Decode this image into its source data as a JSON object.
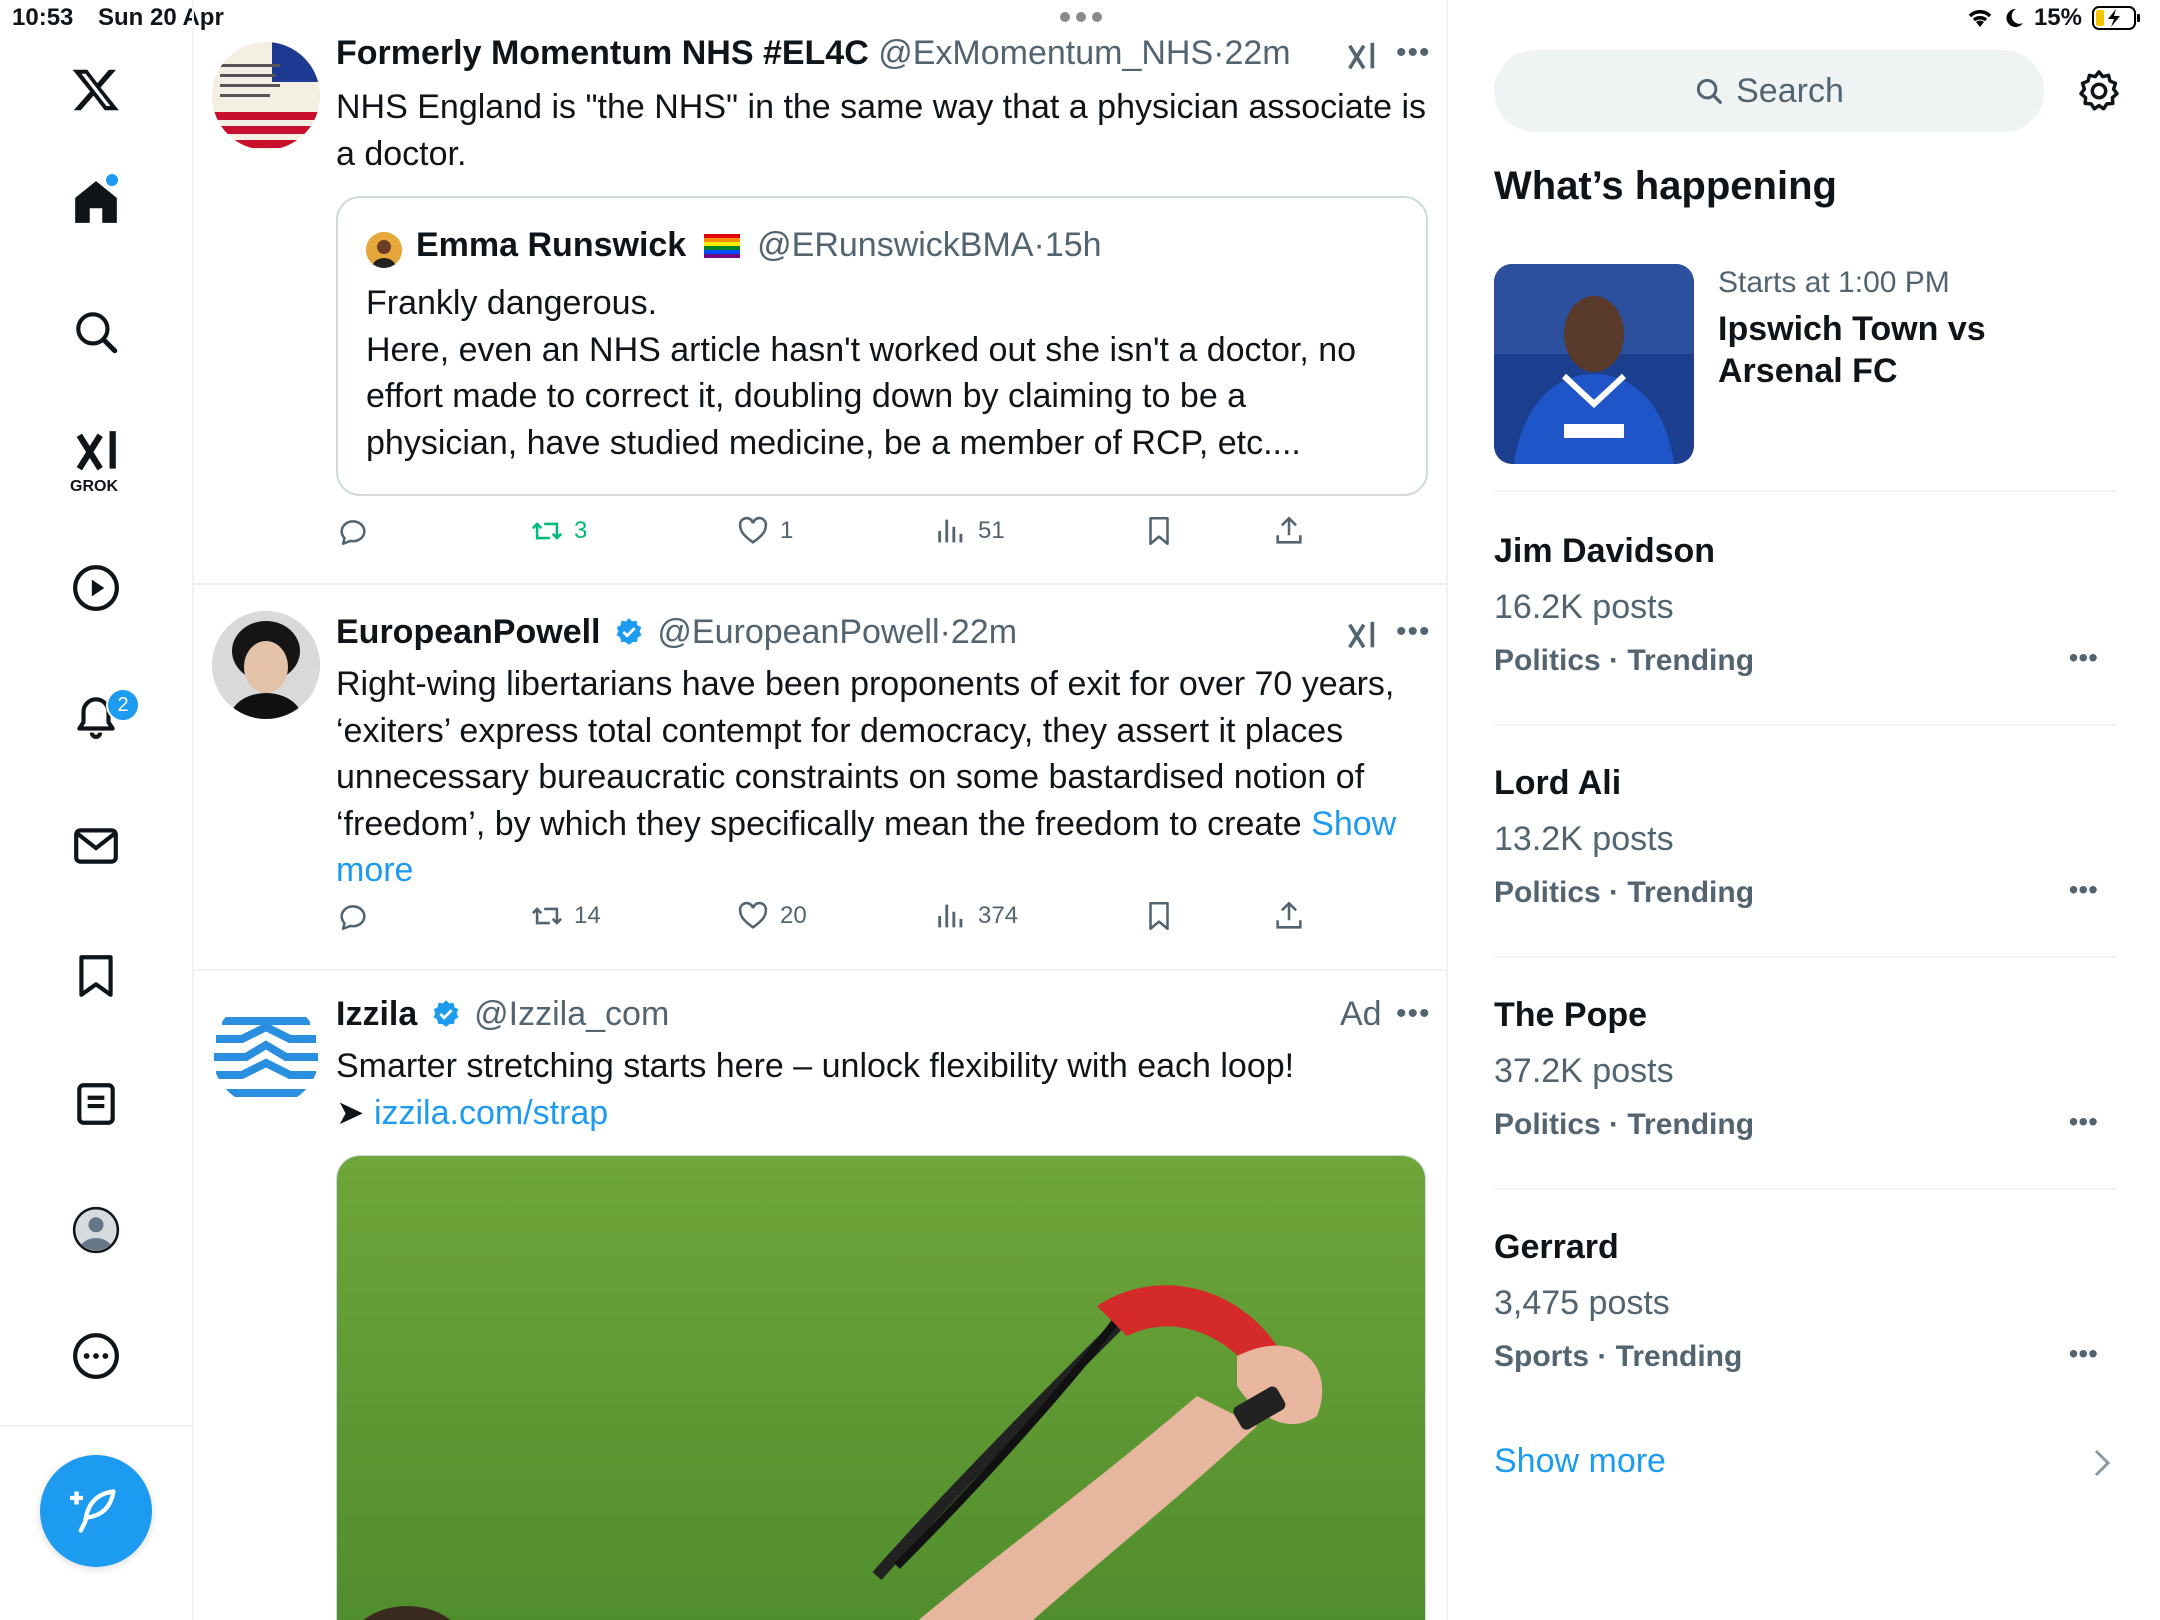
{
  "status_bar": {
    "time": "10:53",
    "date": "Sun 20 Apr",
    "battery": "15%"
  },
  "nav": {
    "items": [
      {
        "name": "x-logo",
        "label": ""
      },
      {
        "name": "home",
        "label": ""
      },
      {
        "name": "explore",
        "label": ""
      },
      {
        "name": "grok",
        "label": "GROK"
      },
      {
        "name": "video",
        "label": ""
      },
      {
        "name": "notifications",
        "label": ""
      },
      {
        "name": "messages",
        "label": ""
      },
      {
        "name": "bookmarks",
        "label": ""
      },
      {
        "name": "lists",
        "label": ""
      },
      {
        "name": "profile",
        "label": ""
      },
      {
        "name": "more",
        "label": ""
      }
    ],
    "grok_label": "GROK",
    "notifications_badge": "2"
  },
  "feed": {
    "posts": [
      {
        "name": "Formerly Momentum NHS #EL4C",
        "handle": "@ExMomentum_NHS",
        "sep": "·",
        "time": "22m",
        "text": "NHS England is \"the NHS\" in the same way that a physician associate is a doctor.",
        "quote": {
          "name": "Emma Runswick",
          "handle": "@ERunswickBMA",
          "sep": "·",
          "time": "15h",
          "text": "Frankly dangerous.\nHere, even an NHS article hasn't worked out she isn't a doctor, no effort made to correct it, doubling down by claiming to be a physician, have studied medicine, be a member of RCP, etc...."
        },
        "stats": {
          "replies": "",
          "reposts": "3",
          "likes": "1",
          "views": "51"
        }
      },
      {
        "name": "EuropeanPowell",
        "handle": "@EuropeanPowell",
        "sep": "·",
        "time": "22m",
        "text": "Right-wing libertarians have been proponents of exit for over 70 years, ‘exiters’ express total contempt for democracy, they assert it places unnecessary bureaucratic constraints on some bastardised notion of ‘freedom’, by which they specifically mean the freedom to create ",
        "show_more": "Show more",
        "stats": {
          "replies": "",
          "reposts": "14",
          "likes": "20",
          "views": "374"
        }
      },
      {
        "name": "Izzila",
        "handle": "@Izzila_com",
        "ad_label": "Ad",
        "text": "Smarter stretching starts here – unlock flexibility with each loop!",
        "arrow": "➤ ",
        "link": "izzila.com/strap"
      }
    ]
  },
  "sidebar": {
    "search_placeholder": "Search",
    "whats_happening": "What’s happening",
    "event": {
      "meta": "Starts at 1:00 PM",
      "title": "Ipswich Town vs Arsenal FC"
    },
    "trends": [
      {
        "title": "Jim Davidson",
        "posts": "16.2K posts",
        "category": "Politics · Trending"
      },
      {
        "title": "Lord Ali",
        "posts": "13.2K posts",
        "category": "Politics · Trending"
      },
      {
        "title": "The Pope",
        "posts": "37.2K posts",
        "category": "Politics · Trending"
      },
      {
        "title": "Gerrard",
        "posts": "3,475 posts",
        "category": "Sports · Trending"
      }
    ],
    "show_more": "Show more"
  },
  "colors": {
    "accent": "#1d9bf0",
    "secondary_text": "#536471",
    "repost_active": "#00ba7c",
    "border": "#eff3f4"
  }
}
